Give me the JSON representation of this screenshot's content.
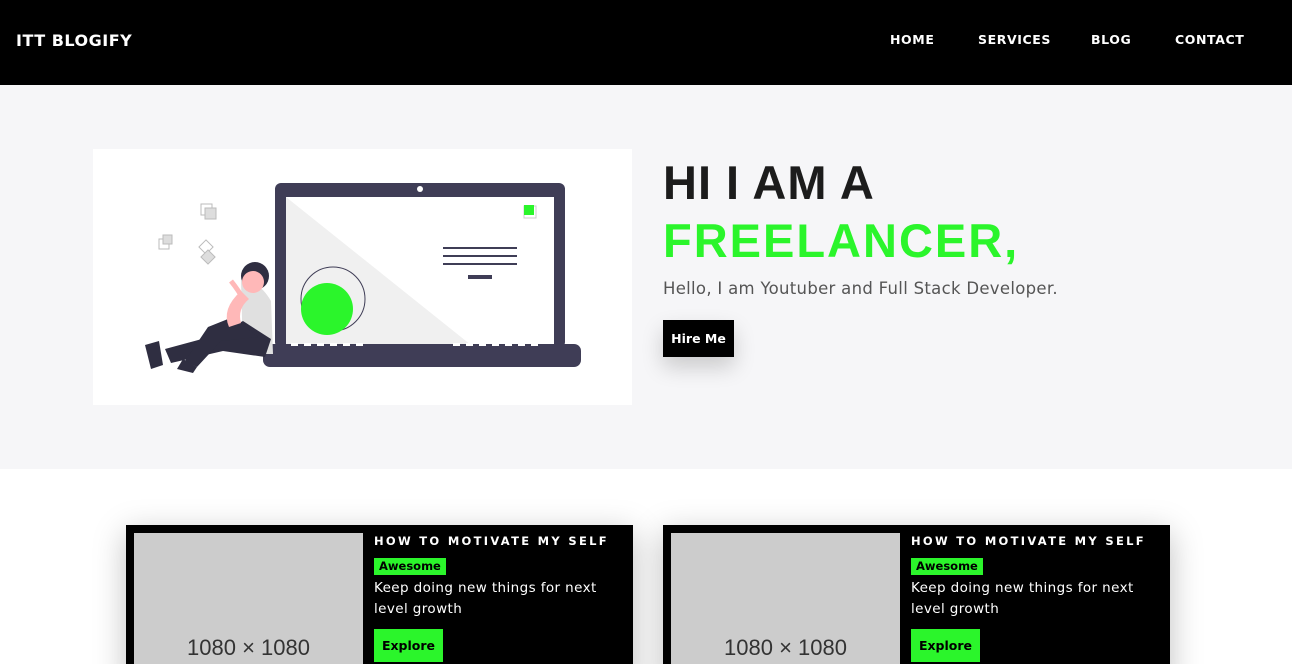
{
  "brand": "ITT BLOGIFY",
  "nav": {
    "home": "HOME",
    "services": "SERVICES",
    "blog": "BLOG",
    "contact": "CONTACT"
  },
  "hero": {
    "title_line1": "HI I AM A",
    "title_line2": "FREELANCER,",
    "subtitle": "Hello, I am Youtuber and Full Stack Developer.",
    "cta": "Hire Me",
    "accent_color": "#2bf52b"
  },
  "cards": [
    {
      "title": "HOW TO MOTIVATE MY SELF",
      "badge": "Awesome",
      "text": "Keep doing new things for next level growth",
      "button": "Explore",
      "image_label": "1080 × 1080"
    },
    {
      "title": "HOW TO MOTIVATE MY SELF",
      "badge": "Awesome",
      "text": "Keep doing new things for next level growth",
      "button": "Explore",
      "image_label": "1080 × 1080"
    }
  ]
}
